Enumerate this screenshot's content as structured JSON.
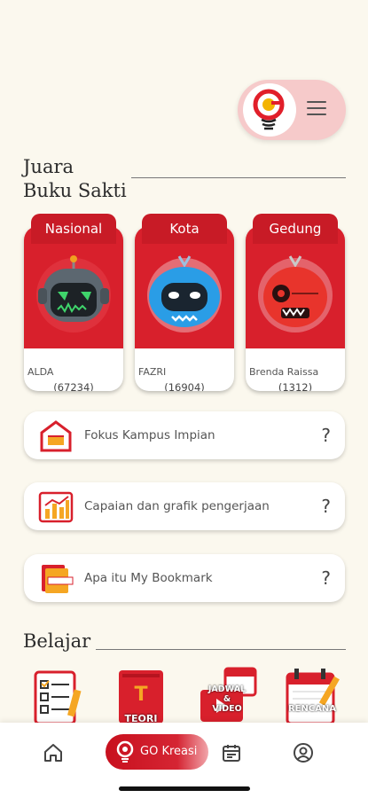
{
  "header": {
    "logo": "go-kreasi-logo",
    "menu_icon": "hamburger-menu-icon"
  },
  "juara": {
    "title_line1": "Juara",
    "title_line2": "Buku Sakti",
    "cards": [
      {
        "tab": "Nasional",
        "name": "ALDA",
        "score": "(67234)",
        "avatar": "dark-gray-robot"
      },
      {
        "tab": "Kota",
        "name": "FAZRI",
        "score": "(16904)",
        "avatar": "blue-robot"
      },
      {
        "tab": "Gedung",
        "name": "Brenda Raissa",
        "score": "(1312)",
        "avatar": "red-robot"
      }
    ]
  },
  "menu_rows": [
    {
      "label": "Fokus Kampus Impian",
      "help": "?",
      "icon": "campus-icon"
    },
    {
      "label": "Capaian dan grafik pengerjaan",
      "help": "?",
      "icon": "chart-icon"
    },
    {
      "label": "Apa itu My Bookmark",
      "help": "?",
      "icon": "bookmark-icon"
    }
  ],
  "belajar": {
    "title": "Belajar",
    "items": [
      {
        "icon": "checklist-icon"
      },
      {
        "label": "TEORI",
        "icon": "teori-book-icon"
      },
      {
        "label_top": "JADWAL",
        "label_mid": "&",
        "label_bottom": "VIDEO",
        "icon": "jadwal-video-icon"
      },
      {
        "label": "RENCANA",
        "icon": "rencana-calendar-icon"
      }
    ]
  },
  "bottom_nav": {
    "active_label": "GO Kreasi",
    "items": [
      "home-icon",
      "go-kreasi-icon",
      "calendar-icon",
      "profile-icon"
    ]
  },
  "colors": {
    "accent": "#d8202c",
    "background": "#fbf8ee",
    "pill": "#f6caca"
  }
}
